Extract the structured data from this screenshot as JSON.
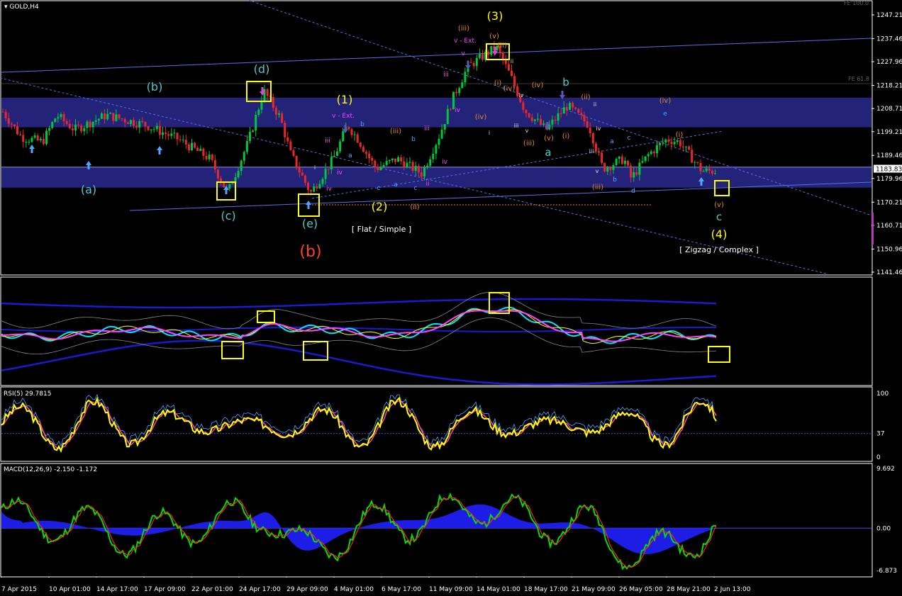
{
  "symbol": "GOLD,H4",
  "colors": {
    "background": "#000000",
    "frame": "#ffffff",
    "bull_candle": "#00c83c",
    "bear_candle": "#e8282d",
    "zone_fill": "#23237a",
    "trendline": "#5a6ee6",
    "highlight_box": "#ffff00",
    "wave_primary": "#ffff00",
    "wave_intermediate": "#4ec9c9",
    "wave_b": "#ff4422",
    "wave_minor_orange": "#e08a2a",
    "wave_minute_magenta": "#ff44ff",
    "wave_minor_blue": "#4da6ff",
    "arrow_up": "#4da6ff",
    "arrow_down": "#dd44dd",
    "rsi_fast": "#ffff00",
    "rsi_slow": "#ff44aa",
    "rsi_band": "#4da6ff",
    "macd_hist": "#2020ff",
    "macd_main": "#00e000",
    "macd_signal": "#ff2222"
  },
  "price_axis": {
    "labels": [
      "1247.21",
      "1237.46",
      "1227.96",
      "1218.21",
      "1208.71",
      "1199.21",
      "1189.46",
      "1179.96",
      "1170.21",
      "1160.71",
      "1150.96",
      "1141.46"
    ],
    "current_price": "1183.83"
  },
  "fib_labels": [
    "FE 100.0",
    "FE 61.8"
  ],
  "time_axis": [
    "7 Apr 2015",
    "10 Apr 01:00",
    "14 Apr 17:00",
    "17 Apr 09:00",
    "22 Apr 01:00",
    "24 Apr 17:00",
    "29 Apr 09:00",
    "4 May 01:00",
    "6 May 17:00",
    "11 May 09:00",
    "14 May 01:00",
    "18 May 17:00",
    "21 May 09:00",
    "26 May 05:00",
    "28 May 21:00",
    "2 Jun 13:00"
  ],
  "wave_labels": {
    "primary": [
      "(1)",
      "(2)",
      "(3)",
      "(4)"
    ],
    "intermediate": [
      "(a)",
      "(b)",
      "(c)",
      "(d)",
      "(e)",
      "a",
      "b",
      "c"
    ],
    "b_wave": "(b)",
    "minor_roman": [
      "(i)",
      "(ii)",
      "(iii)",
      "(iv)",
      "(v)"
    ],
    "minute_roman": [
      "i",
      "ii",
      "iii",
      "iv",
      "v"
    ],
    "minor_letters": [
      "a",
      "b",
      "c",
      "d",
      "e"
    ],
    "extension_notes": [
      "v - Ext.",
      "v - Ext."
    ],
    "pattern_notes": [
      "[ Flat / Simple ]",
      "[ Zigzag / Complex ]"
    ]
  },
  "indicators": {
    "rsi": {
      "caption": "RSI(5) 29.7815",
      "levels": [
        "100",
        "37",
        "0"
      ]
    },
    "macd": {
      "caption": "MACD(12,26,9) -2.150 -1.172",
      "levels": [
        "9.692",
        "0.00",
        "-6.873"
      ]
    }
  },
  "chart_data": [
    {
      "type": "candlestick",
      "title": "GOLD,H4",
      "ylim": [
        1141.46,
        1247.21
      ],
      "x": [
        "7 Apr 2015",
        "10 Apr 01:00",
        "14 Apr 17:00",
        "17 Apr 09:00",
        "22 Apr 01:00",
        "24 Apr 17:00",
        "29 Apr 09:00",
        "4 May 01:00",
        "6 May 17:00",
        "11 May 09:00",
        "14 May 01:00",
        "18 May 17:00",
        "21 May 09:00",
        "26 May 05:00",
        "28 May 21:00",
        "2 Jun 13:00"
      ],
      "close": [
        1209.0,
        1194.0,
        1205.0,
        1201.0,
        1185.0,
        1190.0,
        1185.0,
        1194.0,
        1188.0,
        1205.0,
        1226.0,
        1212.0,
        1205.0,
        1190.0,
        1193.0,
        1184.0
      ],
      "current": 1183.83
    },
    {
      "type": "line",
      "title": "RSI(5) 29.7815",
      "ylim": [
        0,
        100
      ],
      "level": 37,
      "current": 29.7815
    },
    {
      "type": "bar",
      "title": "MACD(12,26,9) -2.150 -1.172",
      "ylim": [
        -6.873,
        9.692
      ],
      "main": -2.15,
      "signal": -1.172
    }
  ]
}
